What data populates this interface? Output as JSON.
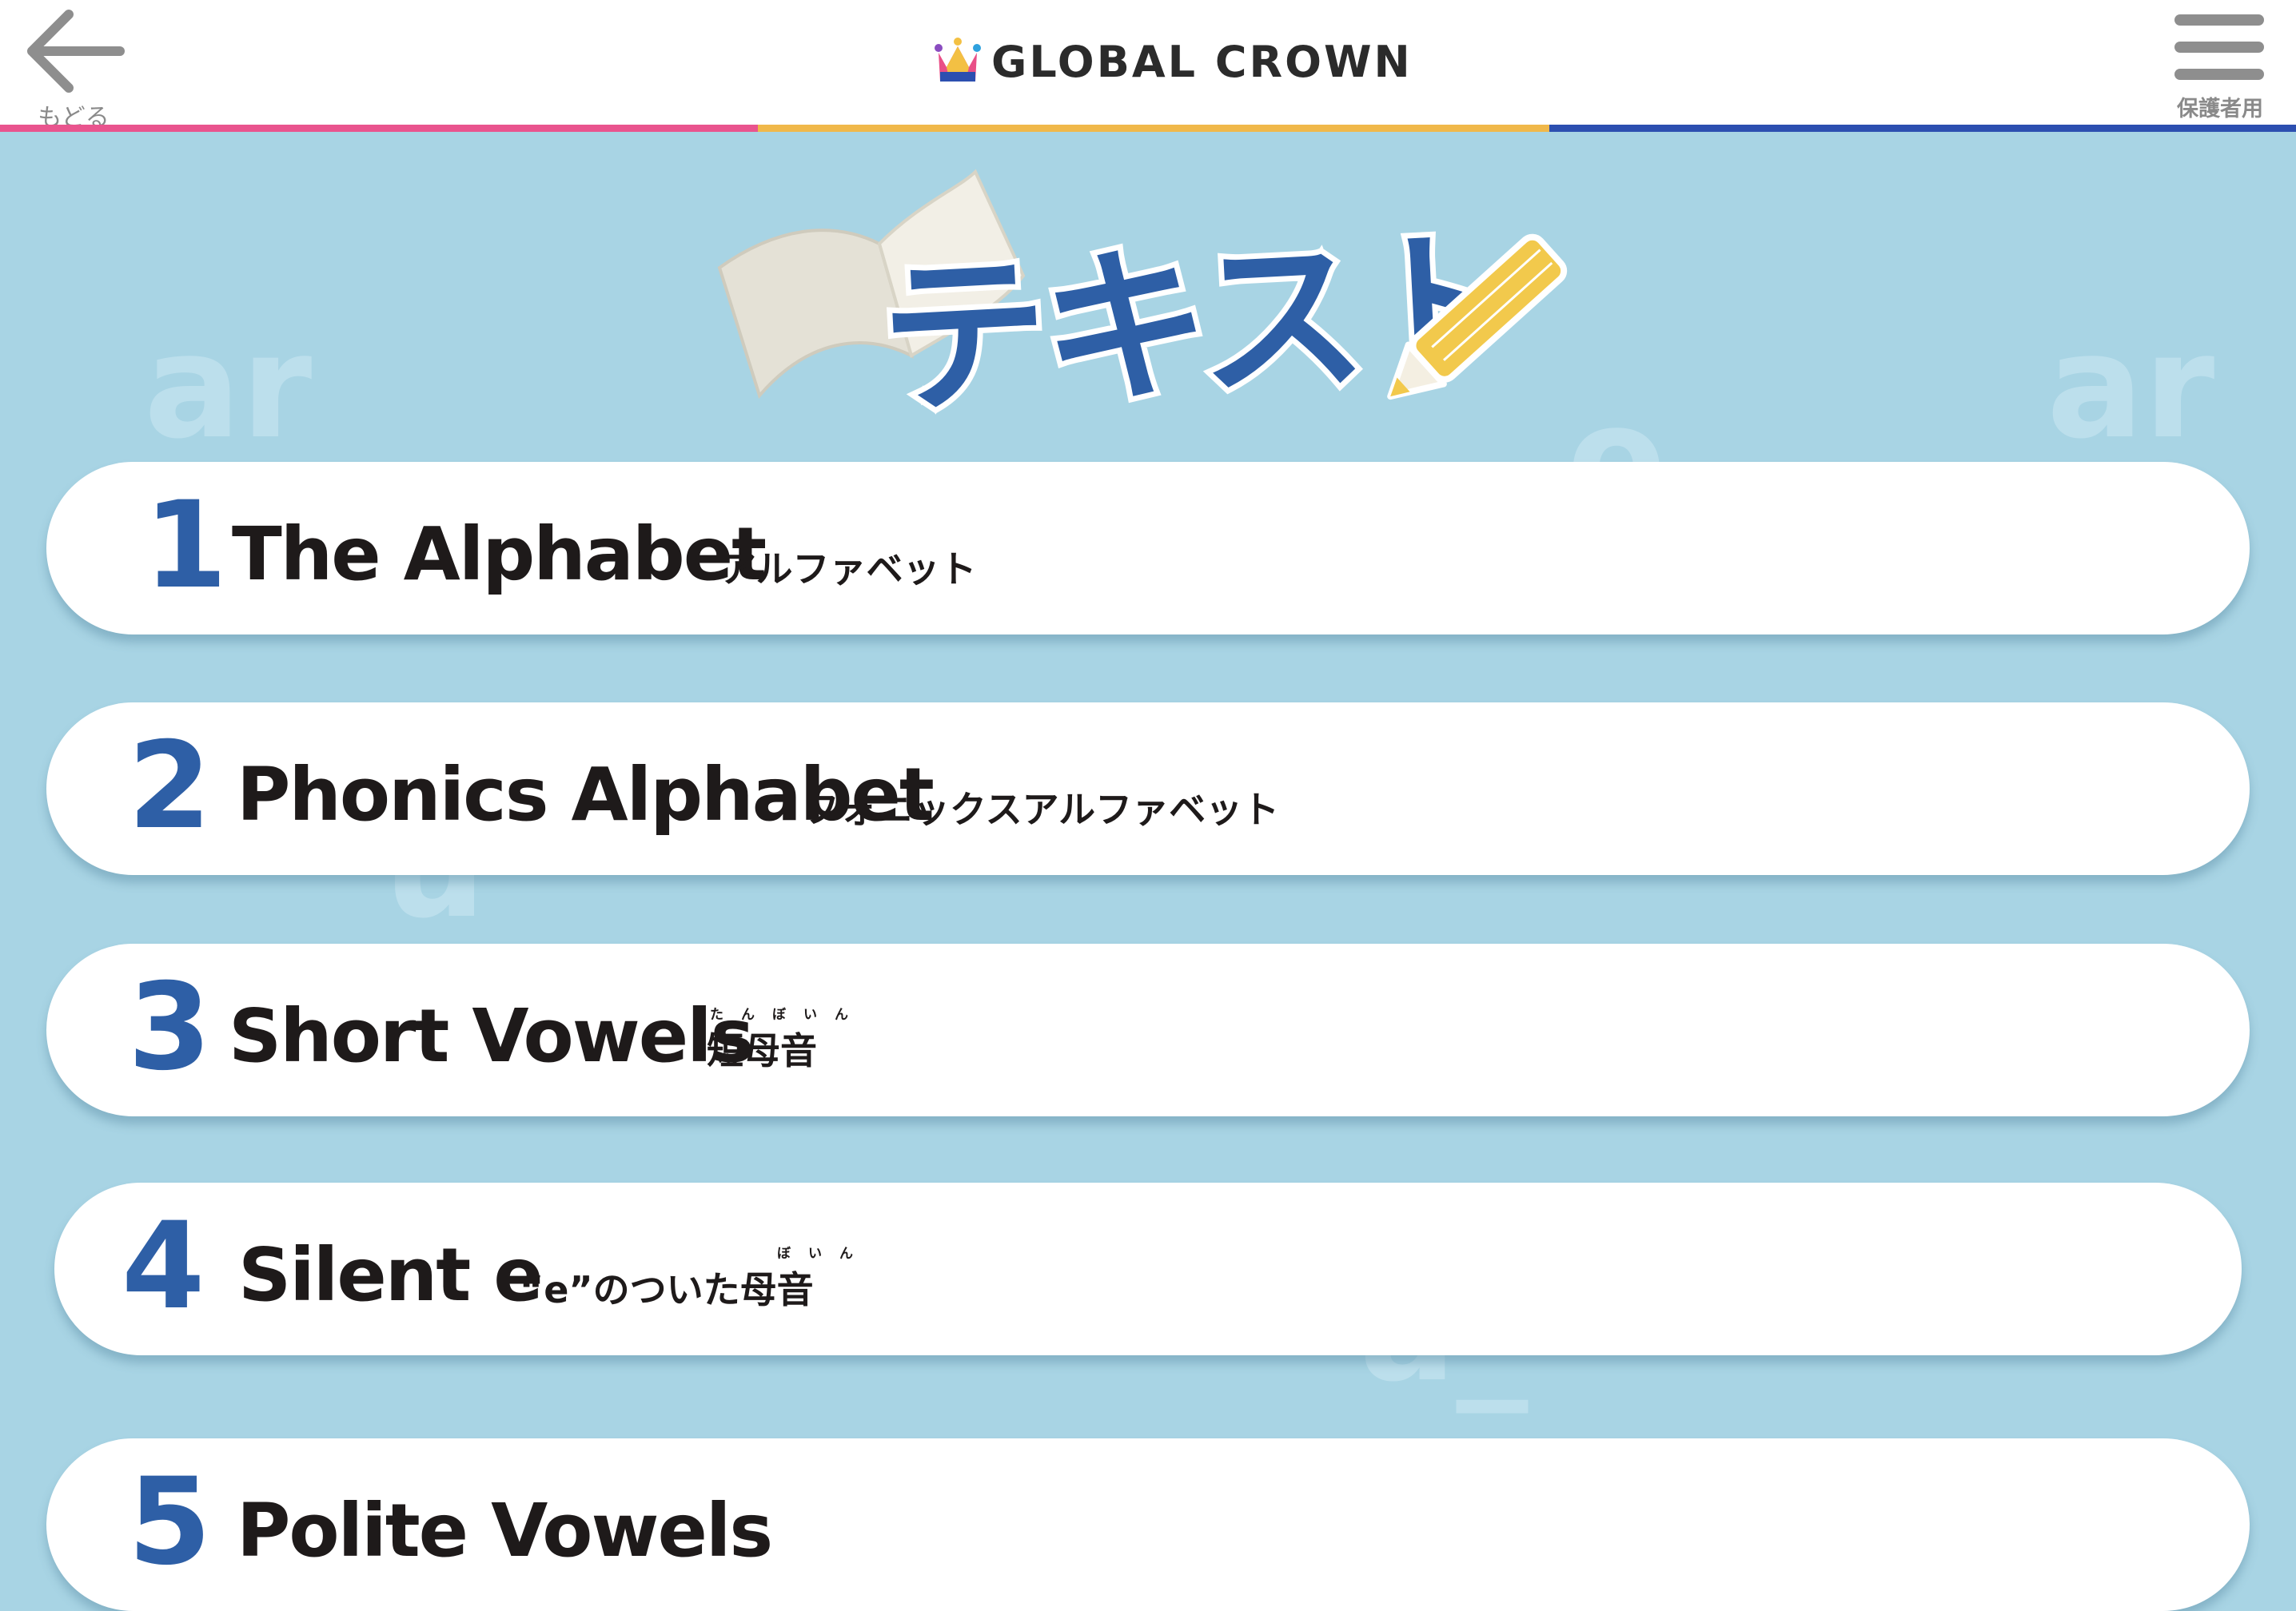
{
  "header": {
    "back_label": "もどる",
    "logo_text": "GLOBAL CROWN",
    "menu_label": "保護者用",
    "bar_colors": [
      "#e9548e",
      "#f0b84a",
      "#2c4fb0"
    ]
  },
  "page": {
    "title": "テキスト"
  },
  "colors": {
    "background": "#a8d4e4",
    "accent_blue": "#2e5fa6",
    "text_dark": "#1e1a1a"
  },
  "lessons": [
    {
      "number": "1",
      "title": "The Alphabet",
      "subtitle": "アルファベット",
      "ruby": ""
    },
    {
      "number": "2",
      "title": "Phonics Alphabet",
      "subtitle": "フォニックスアルファベット",
      "ruby": ""
    },
    {
      "number": "3",
      "title": "Short Vowels",
      "subtitle": "短母音",
      "ruby": "たんぼいん"
    },
    {
      "number": "4",
      "title": "Silent e",
      "subtitle": "“e”のついた母音",
      "ruby": "ぼいん"
    },
    {
      "number": "5",
      "title": "Polite Vowels",
      "subtitle": "",
      "ruby": ""
    }
  ]
}
